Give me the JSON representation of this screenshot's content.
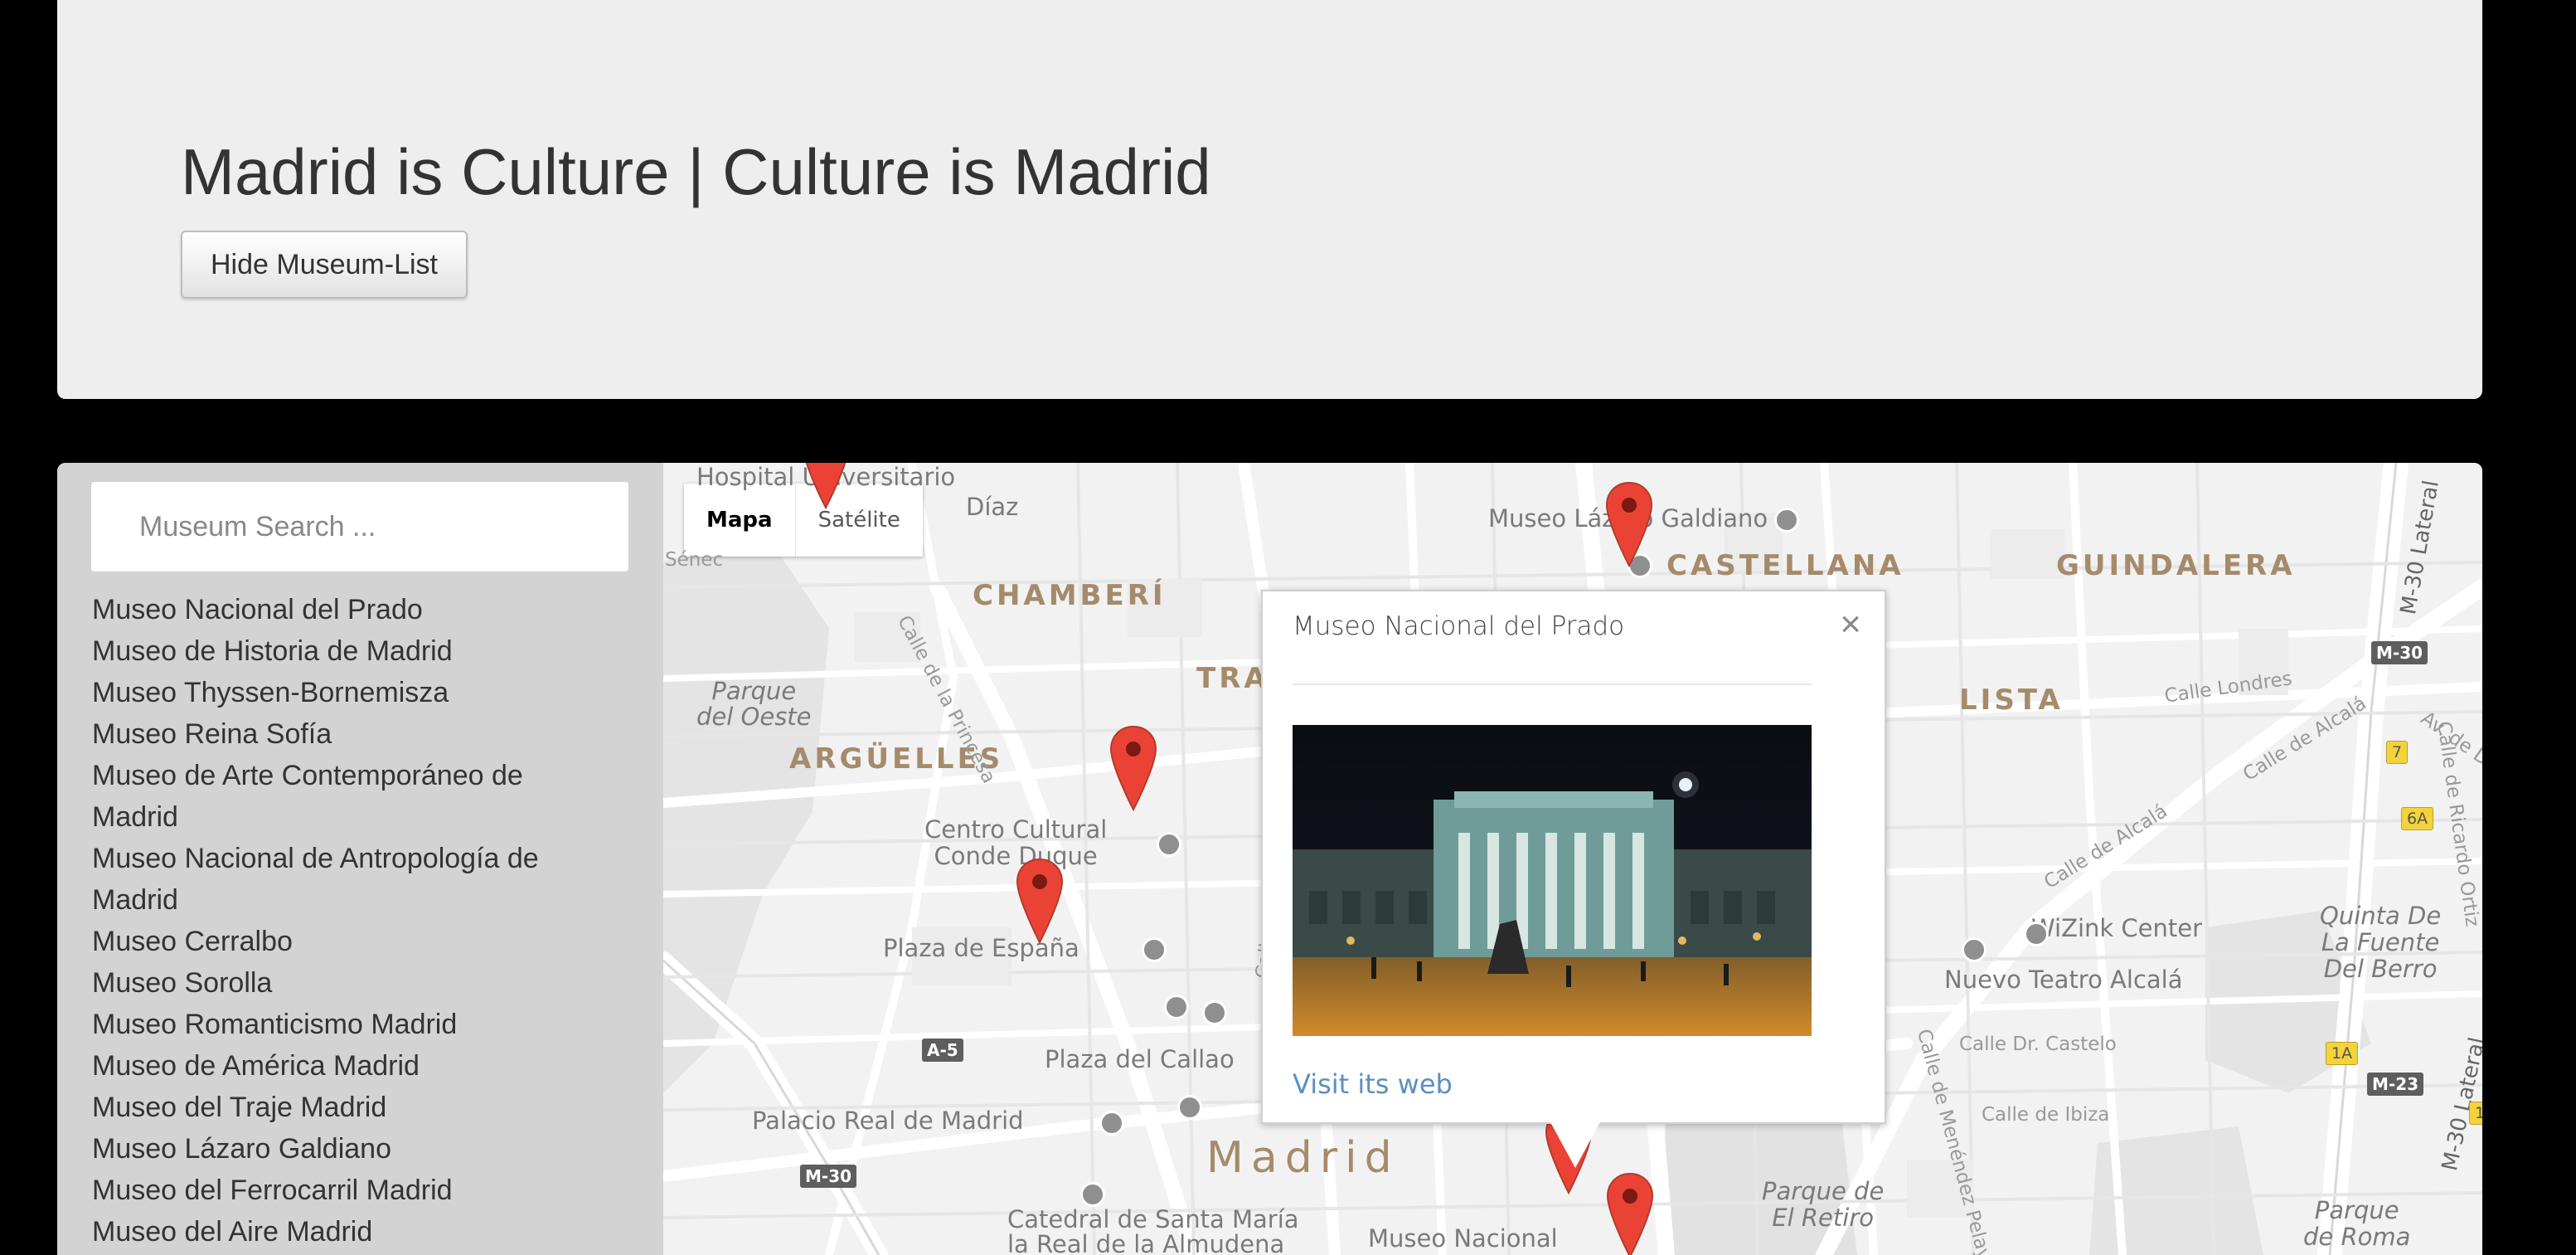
{
  "header": {
    "title": "Madrid is Culture | Culture is Madrid",
    "toggle_button": "Hide Museum-List"
  },
  "sidebar": {
    "search_placeholder": "Museum Search ...",
    "museums": [
      "Museo Nacional del Prado",
      "Museo de Historia de Madrid",
      "Museo Thyssen-Bornemisza",
      "Museo Reina Sofía",
      "Museo de Arte Contemporáneo de Madrid",
      "Museo Nacional de Antropología de Madrid",
      "Museo Cerralbo",
      "Museo Sorolla",
      "Museo Romanticismo Madrid",
      "Museo de América Madrid",
      "Museo del Traje Madrid",
      "Museo Lázaro Galdiano",
      "Museo del Ferrocarril Madrid",
      "Museo del Aire Madrid"
    ]
  },
  "map": {
    "type_controls": {
      "map": "Mapa",
      "satellite": "Satélite"
    },
    "labels": {
      "chamberi": "CHAMBERÍ",
      "arguelles": "ARGÜELLES",
      "castellana": "CASTELLANA",
      "guindalera": "GUINDALERA",
      "lista": "LISTA",
      "tra": "TRA",
      "madrid": "Madrid",
      "hospital": "Hospital Universitario",
      "diaz": "Díaz",
      "senec": "Sénec",
      "parque_oeste": "Parque\ndel Oeste",
      "museo_lazaro": "Museo Lázaro Galdiano",
      "centro_cultural": "Centro Cultural\nConde Duque",
      "plaza_espana": "Plaza de España",
      "plaza_callao": "Plaza del Callao",
      "palacio_real": "Palacio Real de Madrid",
      "catedral": "Catedral de Santa María\nla Real de la Almudena",
      "museo_nacional": "Museo Nacional",
      "wizink": "WiZink Center",
      "nuevo_teatro": "Nuevo Teatro Alcalá",
      "quinta": "Quinta De\nLa Fuente\nDel Berro",
      "parque_retiro": "Parque de\nEl Retiro",
      "parque_roma": "Parque\nde Roma",
      "calle_princesa": "Calle de la Princesa",
      "calle_san_bernardo": "Calle de San Bernardo",
      "calle_londres": "Calle Londres",
      "calle_alcala_1": "Calle de Alcalá",
      "calle_alcala_2": "Calle de Alcalá",
      "calle_castelo": "Calle Dr. Castelo",
      "calle_ibiza": "Calle de Ibiza",
      "calle_ricardo": "Calle de Ricardo Ortiz",
      "menendez": "Calle de Menéndez Pelay",
      "m30_lateral_1": "M-30 Lateral",
      "m30_lateral_2": "M-30 Lateral",
      "av_de": "Av. de D"
    },
    "shields": {
      "a5": "A-5",
      "m30_a": "M-30",
      "m30_b": "M-30",
      "m23": "M-23",
      "s7": "7",
      "s6a": "6A",
      "s1a": "1A",
      "s1": "1"
    },
    "accent_color": "#ea4335"
  },
  "infowindow": {
    "title": "Museo Nacional del Prado",
    "link": "Visit its web",
    "close": "×"
  }
}
